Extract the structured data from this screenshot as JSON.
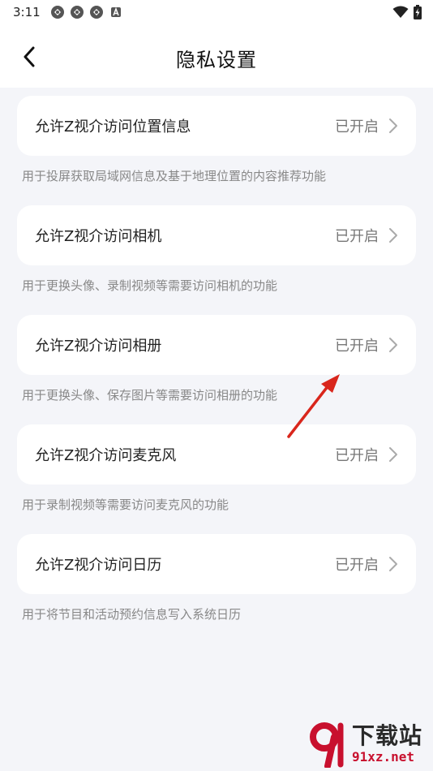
{
  "status_bar": {
    "time": "3:11",
    "notification_icons": [
      "app-notification-icon",
      "app-notification-icon",
      "app-notification-icon",
      "a-notification-icon"
    ],
    "right_icons": [
      "wifi-icon",
      "battery-charging-icon"
    ]
  },
  "header": {
    "title": "隐私设置",
    "back_icon": "chevron-left-icon"
  },
  "settings": [
    {
      "label": "允许Z视介访问位置信息",
      "status": "已开启",
      "description": "用于投屏获取局域网信息及基于地理位置的内容推荐功能"
    },
    {
      "label": "允许Z视介访问相机",
      "status": "已开启",
      "description": "用于更换头像、录制视频等需要访问相机的功能"
    },
    {
      "label": "允许Z视介访问相册",
      "status": "已开启",
      "description": "用于更换头像、保存图片等需要访问相册的功能"
    },
    {
      "label": "允许Z视介访问麦克风",
      "status": "已开启",
      "description": "用于录制视频等需要访问麦克风的功能"
    },
    {
      "label": "允许Z视介访问日历",
      "status": "已开启",
      "description": "用于将节目和活动预约信息写入系统日历"
    }
  ],
  "watermark": {
    "title": "下载站",
    "url": "91xz.net"
  },
  "colors": {
    "background": "#f4f5f9",
    "card": "#ffffff",
    "annotation_arrow": "#d9261c",
    "watermark_red": "#c8102e"
  }
}
